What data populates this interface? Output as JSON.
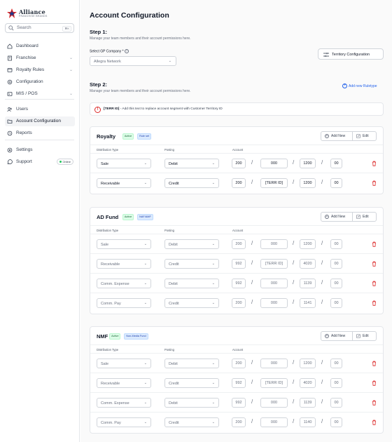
{
  "brand": {
    "name": "Alliance",
    "subtitle": "FRANCHISE BRANDS"
  },
  "search": {
    "placeholder": "Search",
    "shortcut": "⌘K"
  },
  "nav": [
    {
      "label": "Dashboard",
      "icon": "home-icon"
    },
    {
      "label": "Franchise",
      "icon": "building-icon",
      "chevron": true
    },
    {
      "label": "Royalty Rules",
      "icon": "receipt-icon",
      "chevron": true
    },
    {
      "label": "Configuration",
      "icon": "gear-icon"
    },
    {
      "label": "MIS / POS",
      "icon": "terminal-icon",
      "chevron": true
    }
  ],
  "nav2": [
    {
      "label": "Users",
      "icon": "users-icon"
    },
    {
      "label": "Account Configuration",
      "icon": "folder-icon",
      "active": true
    },
    {
      "label": "Reports",
      "icon": "clock-icon"
    }
  ],
  "nav3": [
    {
      "label": "Settings",
      "icon": "settings-icon"
    },
    {
      "label": "Support",
      "icon": "support-icon",
      "badge": "Online"
    }
  ],
  "page": {
    "title": "Account Configuration"
  },
  "step1": {
    "title": "Step 1:",
    "desc": "Manage your team members and their account permissions here.",
    "gp_label": "Select GP Company *",
    "gp_value": "Allegra Network",
    "territory_btn": "Territory Configuration"
  },
  "step2": {
    "title": "Step 2:",
    "desc": "Manage your team members and their account permissions here.",
    "add_ruletype": "Add new Ruletype"
  },
  "alert": {
    "code": "[TERR ID]",
    "text": " - Add this text to replace account segment with Customer Territory ID"
  },
  "table_headers": {
    "dist": "Distribution Type",
    "posting": "Posting",
    "account": "Account"
  },
  "buttons": {
    "add_new": "Add New",
    "edit": "Edit"
  },
  "cards": [
    {
      "title": "Royalty",
      "tags": [
        {
          "text": "Active",
          "color": "green"
        },
        {
          "text": "Rule set",
          "color": "blue"
        }
      ],
      "muted": false,
      "rows": [
        {
          "dist": "Sale",
          "posting": "Debit",
          "acct": [
            "200",
            "000",
            "1200",
            "00"
          ]
        },
        {
          "dist": "Receivable",
          "posting": "Credit",
          "acct": [
            "200",
            "[TERR ID]",
            "1200",
            "00"
          ]
        }
      ]
    },
    {
      "title": "AD Fund",
      "tags": [
        {
          "text": "Active",
          "color": "green"
        },
        {
          "text": "NAF/AMF",
          "color": "blue"
        }
      ],
      "muted": true,
      "rows": [
        {
          "dist": "Sale",
          "posting": "Debit",
          "acct": [
            "200",
            "000",
            "1200",
            "00"
          ]
        },
        {
          "dist": "Receivable",
          "posting": "Credit",
          "acct": [
            "992",
            "[TERR ID]",
            "4020",
            "00"
          ]
        },
        {
          "dist": "Comm. Expense",
          "posting": "Debit",
          "acct": [
            "992",
            "000",
            "1139",
            "00"
          ]
        },
        {
          "dist": "Comm. Pay",
          "posting": "Credit",
          "acct": [
            "200",
            "000",
            "1141",
            "00"
          ]
        }
      ]
    },
    {
      "title": "NMF",
      "tags": [
        {
          "text": "Active",
          "color": "green"
        },
        {
          "text": "Non-Media Fund",
          "color": "blue"
        }
      ],
      "muted": true,
      "rows": [
        {
          "dist": "Sale",
          "posting": "Debit",
          "acct": [
            "200",
            "000",
            "1200",
            "00"
          ]
        },
        {
          "dist": "Receivable",
          "posting": "Credit",
          "acct": [
            "992",
            "[TERR ID]",
            "4020",
            "00"
          ]
        },
        {
          "dist": "Comm. Expense",
          "posting": "Debit",
          "acct": [
            "992",
            "000",
            "1139",
            "00"
          ]
        },
        {
          "dist": "Comm. Pay",
          "posting": "Credit",
          "acct": [
            "200",
            "000",
            "1140",
            "00"
          ]
        }
      ]
    }
  ],
  "colors": {
    "accent": "#2563eb",
    "danger": "#dc2626",
    "active_green": "#166534",
    "tag_blue": "#1e40af"
  }
}
